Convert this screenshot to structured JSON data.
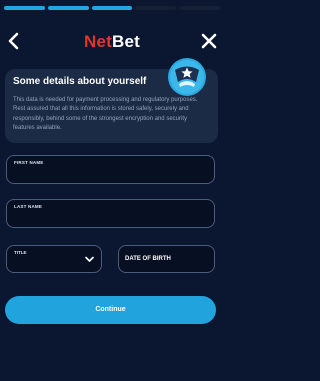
{
  "progress": {
    "completed_steps": 3,
    "total_steps": 5
  },
  "header": {
    "logo_net": "Net",
    "logo_bet": "Bet",
    "back_icon": "chevron-left-icon",
    "close_icon": "close-icon"
  },
  "info": {
    "title": "Some details about yourself",
    "text": "This data is needed for payment processing and regulatory purposes. Rest assured that all this information is stored safely, securely and responsibly, behind some of the strongest encryption and security features available.",
    "badge_icon": "shield-star-icon"
  },
  "form": {
    "first_name_label": "FIRST NAME",
    "last_name_label": "LAST NAME",
    "title_label": "TITLE",
    "dob_placeholder": "DATE OF BIRTH",
    "title_icon": "chevron-down-icon"
  },
  "actions": {
    "continue_label": "Continue"
  },
  "colors": {
    "background": "#0b1630",
    "accent": "#21a3dd",
    "brand_red": "#e5342f",
    "card": "#1b2a45"
  }
}
